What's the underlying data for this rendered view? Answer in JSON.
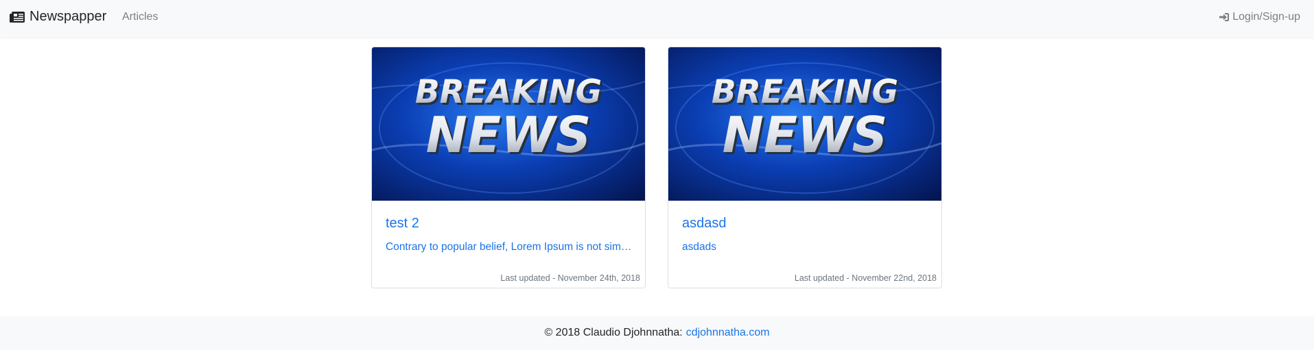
{
  "navbar": {
    "brand": "Newspapper",
    "brand_icon": "newspaper-icon",
    "links": [
      "Articles"
    ],
    "login_label": "Login/Sign-up",
    "login_icon": "sign-in-icon"
  },
  "articles": [
    {
      "title": "test 2",
      "excerpt": "Contrary to popular belief, Lorem Ipsum is not simply random text.",
      "updated": "Last updated - November 24th, 2018",
      "image_text_top": "BREAKING",
      "image_text_bottom": "NEWS"
    },
    {
      "title": "asdasd",
      "excerpt": "asdads",
      "updated": "Last updated - November 22nd, 2018",
      "image_text_top": "BREAKING",
      "image_text_bottom": "NEWS"
    }
  ],
  "footer": {
    "copyright": "© 2018 Claudio Djohnnatha:",
    "link": "cdjohnnatha.com"
  },
  "colors": {
    "link": "#1a73e8",
    "navbar_bg": "#f8f9fa",
    "muted": "#7b7f83"
  }
}
